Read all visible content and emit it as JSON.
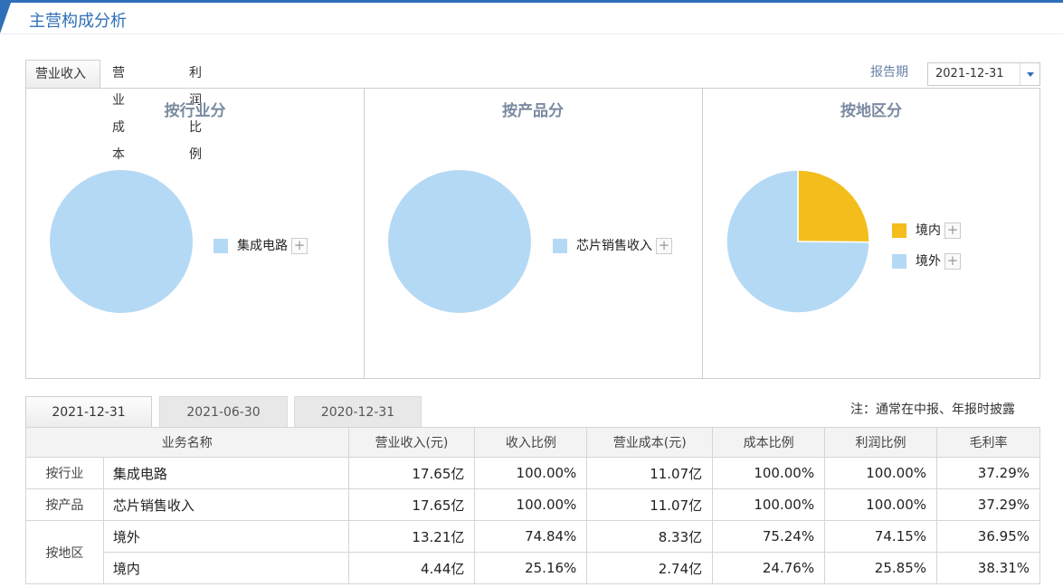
{
  "header": {
    "title": "主营构成分析"
  },
  "tabs": [
    "营业收入",
    "营业成本",
    "利润比例"
  ],
  "report": {
    "label": "报告期",
    "selected": "2021-12-31"
  },
  "colors": {
    "blue": "#b4d9f5",
    "yellow": "#f3bd1c",
    "accent": "#2f6fb8"
  },
  "panels": [
    {
      "title": "按行业分",
      "legend": [
        "集成电路"
      ]
    },
    {
      "title": "按产品分",
      "legend": [
        "芯片销售收入"
      ]
    },
    {
      "title": "按地区分",
      "legend": [
        "境内",
        "境外"
      ]
    }
  ],
  "chart_data": [
    {
      "type": "pie",
      "title": "按行业分",
      "labels": [
        "集成电路"
      ],
      "values": [
        100.0
      ]
    },
    {
      "type": "pie",
      "title": "按产品分",
      "labels": [
        "芯片销售收入"
      ],
      "values": [
        100.0
      ]
    },
    {
      "type": "pie",
      "title": "按地区分",
      "labels": [
        "境内",
        "境外"
      ],
      "values": [
        25.16,
        74.84
      ]
    }
  ],
  "period_tabs": [
    "2021-12-31",
    "2021-06-30",
    "2020-12-31"
  ],
  "note": "注：通常在中报、年报时披露",
  "table": {
    "headers": [
      "业务名称",
      "营业收入(元)",
      "收入比例",
      "营业成本(元)",
      "成本比例",
      "利润比例",
      "毛利率"
    ],
    "groups": [
      "按行业",
      "按产品",
      "按地区"
    ],
    "rows": [
      [
        "集成电路",
        "17.65亿",
        "100.00%",
        "11.07亿",
        "100.00%",
        "100.00%",
        "37.29%"
      ],
      [
        "芯片销售收入",
        "17.65亿",
        "100.00%",
        "11.07亿",
        "100.00%",
        "100.00%",
        "37.29%"
      ],
      [
        "境外",
        "13.21亿",
        "74.84%",
        "8.33亿",
        "75.24%",
        "74.15%",
        "36.95%"
      ],
      [
        "境内",
        "4.44亿",
        "25.16%",
        "2.74亿",
        "24.76%",
        "25.85%",
        "38.31%"
      ]
    ]
  }
}
